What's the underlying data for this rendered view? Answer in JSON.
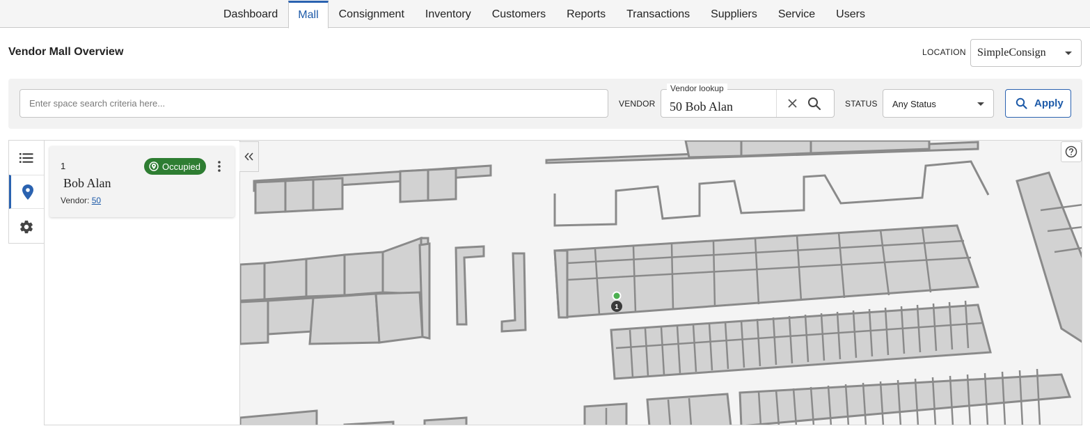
{
  "nav": {
    "tabs": [
      {
        "label": "Dashboard"
      },
      {
        "label": "Mall"
      },
      {
        "label": "Consignment"
      },
      {
        "label": "Inventory"
      },
      {
        "label": "Customers"
      },
      {
        "label": "Reports"
      },
      {
        "label": "Transactions"
      },
      {
        "label": "Suppliers"
      },
      {
        "label": "Service"
      },
      {
        "label": "Users"
      }
    ],
    "active_tab": "Mall"
  },
  "header": {
    "title": "Vendor Mall Overview",
    "location_label": "LOCATION",
    "location_value": "SimpleConsign"
  },
  "filters": {
    "search_placeholder": "Enter space search criteria here...",
    "vendor_label": "VENDOR",
    "vendor_lookup_label": "Vendor lookup",
    "vendor_value": "50 Bob Alan",
    "status_label": "STATUS",
    "status_value": "Any Status",
    "apply_label": "Apply"
  },
  "spaces": [
    {
      "number": "1",
      "name": "Bob Alan",
      "status": "Occupied",
      "vendor_label": "Vendor:",
      "vendor_id": "50"
    }
  ],
  "map": {
    "marker_label": "1"
  },
  "colors": {
    "accent": "#2a62b0",
    "occupied": "#2e7d32"
  }
}
